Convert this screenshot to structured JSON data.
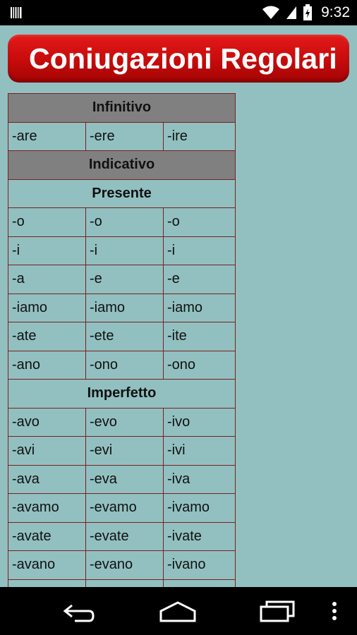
{
  "status_bar": {
    "time": "9:32",
    "icons": [
      "barcode-icon",
      "wifi-icon",
      "signal-icon",
      "battery-charging-icon"
    ]
  },
  "header": {
    "title": "Coniugazioni Regolari"
  },
  "table": {
    "rows": [
      {
        "type": "section",
        "label": "Infinitivo"
      },
      {
        "type": "row",
        "cells": [
          "-are",
          "-ere",
          "-ire"
        ]
      },
      {
        "type": "section",
        "label": "Indicativo"
      },
      {
        "type": "subsection",
        "label": "Presente"
      },
      {
        "type": "row",
        "cells": [
          "-o",
          "-o",
          "-o"
        ]
      },
      {
        "type": "row",
        "cells": [
          "-i",
          "-i",
          "-i"
        ]
      },
      {
        "type": "row",
        "cells": [
          "-a",
          "-e",
          "-e"
        ]
      },
      {
        "type": "row",
        "cells": [
          "-iamo",
          "-iamo",
          "-iamo"
        ]
      },
      {
        "type": "row",
        "cells": [
          "-ate",
          "-ete",
          "-ite"
        ]
      },
      {
        "type": "row",
        "cells": [
          "-ano",
          "-ono",
          "-ono"
        ]
      },
      {
        "type": "subsection",
        "label": "Imperfetto"
      },
      {
        "type": "row",
        "cells": [
          "-avo",
          "-evo",
          "-ivo"
        ]
      },
      {
        "type": "row",
        "cells": [
          "-avi",
          "-evi",
          "-ivi"
        ]
      },
      {
        "type": "row",
        "cells": [
          "-ava",
          "-eva",
          "-iva"
        ]
      },
      {
        "type": "row",
        "cells": [
          "-avamo",
          "-evamo",
          "-ivamo"
        ]
      },
      {
        "type": "row",
        "cells": [
          "-avate",
          "-evate",
          "-ivate"
        ]
      },
      {
        "type": "row",
        "cells": [
          "-avano",
          "-evano",
          "-ivano"
        ]
      },
      {
        "type": "row",
        "cells": [
          "",
          "",
          ""
        ]
      }
    ]
  },
  "nav_bar": {
    "icons": [
      "back-icon",
      "home-icon",
      "recent-apps-icon",
      "overflow-menu-icon"
    ]
  },
  "colors": {
    "background": "#92c0c0",
    "banner": "#c60b0b",
    "section_header": "#808080",
    "border": "#7a1f1f"
  }
}
